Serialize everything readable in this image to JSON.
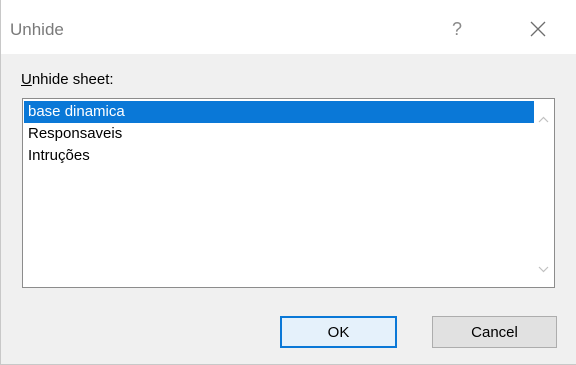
{
  "window": {
    "title": "Unhide",
    "help_label": "?"
  },
  "dialog": {
    "label_accesskey": "U",
    "label_rest": "nhide sheet:",
    "sheets": [
      {
        "label": "base dinamica",
        "selected": true
      },
      {
        "label": "Responsaveis",
        "selected": false
      },
      {
        "label": "Intruções",
        "selected": false
      }
    ]
  },
  "buttons": {
    "ok_label": "OK",
    "cancel_label": "Cancel"
  },
  "colors": {
    "selection": "#0a78d7",
    "title_text": "#7a7a7a",
    "background": "#f0f0f0"
  },
  "icons": {
    "close": "close-icon",
    "help": "help-icon",
    "scroll_up": "chevron-up-icon",
    "scroll_down": "chevron-down-icon"
  }
}
